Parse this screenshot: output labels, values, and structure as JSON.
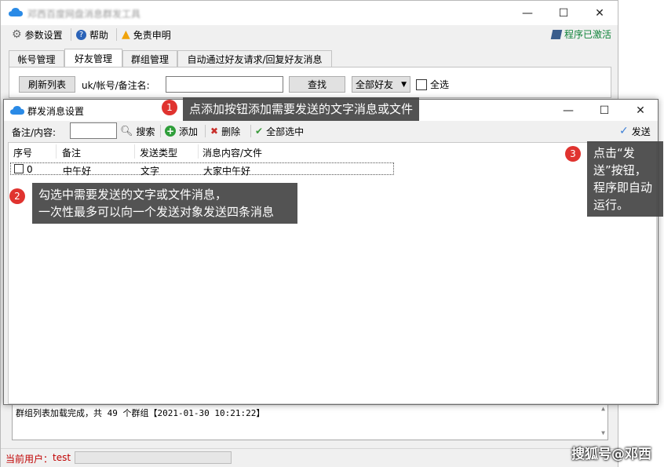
{
  "main_window": {
    "title": "邓西百度网盘消息群发工具",
    "toolbar": {
      "settings": "参数设置",
      "help": "帮助",
      "disclaimer": "免责申明",
      "activated": "程序已激活"
    },
    "tabs": [
      "帐号管理",
      "好友管理",
      "群组管理",
      "自动通过好友请求/回复好友消息"
    ],
    "active_tab": "好友管理",
    "friends_panel": {
      "refresh_button": "刷新列表",
      "search_label": "uk/帐号/备注名:",
      "search_value": "",
      "find_button": "查找",
      "filter_value": "全部好友",
      "select_all_label": "全选"
    },
    "log_text": "群组列表加载完成，共 49 个群组【2021-01-30 10:21:22】",
    "status": {
      "current_user_label": "当前用户：",
      "current_user": "test"
    }
  },
  "dialog": {
    "title": "群发消息设置",
    "toolbar": {
      "filter_label": "备注/内容:",
      "filter_value": "",
      "search": "搜索",
      "add": "添加",
      "delete": "删除",
      "select_all": "全部选中",
      "send": "发送"
    },
    "columns": [
      "序号",
      "备注",
      "发送类型",
      "消息内容/文件"
    ],
    "rows": [
      {
        "index": "0",
        "note": "中午好",
        "type": "文字",
        "content": "大家中午好",
        "checked": false
      }
    ]
  },
  "callouts": [
    {
      "number": "1",
      "text": "点添加按钮添加需要发送的文字消息或文件"
    },
    {
      "number": "2",
      "text_line1": "勾选中需要发送的文字或文件消息，",
      "text_line2": "一次性最多可以向一个发送对象发送四条消息"
    },
    {
      "number": "3",
      "text": "点击“发送”按钮，程序即自动运行。"
    }
  ],
  "watermark": "搜狐号@邓西",
  "colors": {
    "accent_green": "#10833a",
    "badge_red": "#e0332f",
    "status_red": "#c00000",
    "cloud_blue": "#2a8ae6"
  }
}
